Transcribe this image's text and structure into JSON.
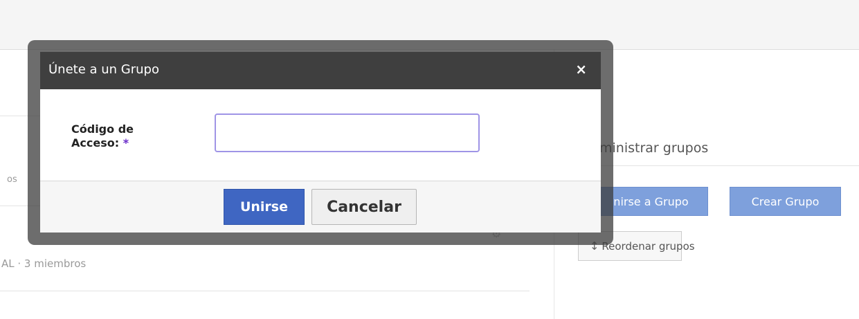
{
  "background": {
    "left_list": {
      "item_fragment_1": "os",
      "item_fragment_2": "AL · 3 miembros"
    },
    "admin_panel": {
      "title": "ministrar grupos",
      "join_button_label": "nirse a Grupo",
      "create_button_label": "Crear Grupo",
      "reorder_button_label": "Reordenar grupos"
    }
  },
  "modal": {
    "title": "Únete a un Grupo",
    "close_icon": "×",
    "access_code": {
      "label_line1": "Código de",
      "label_line2": "Acceso:",
      "required_mark": "*",
      "value": "",
      "placeholder": ""
    },
    "join_label": "Unirse",
    "cancel_label": "Cancelar"
  },
  "colors": {
    "primary_button": "#3f66c2",
    "secondary_button_bg": "#7ea0dc",
    "modal_header": "#3f3f3f",
    "required_mark": "#6a2cc9"
  }
}
